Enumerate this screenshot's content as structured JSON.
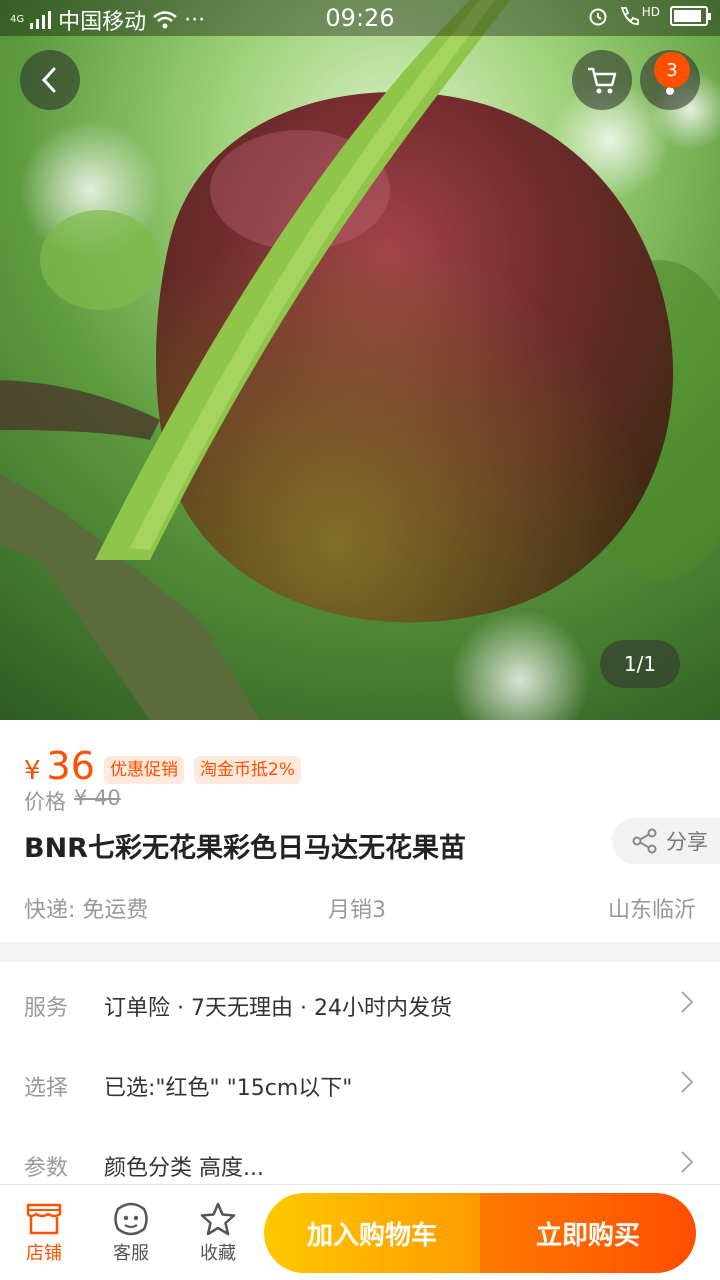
{
  "status_bar": {
    "network": "4G",
    "carrier": "中国移动",
    "more": "···",
    "time": "09:26",
    "hd": "HD",
    "battery_level": 0.9
  },
  "gallery": {
    "pager": "1/1",
    "cart_badge": "3"
  },
  "product": {
    "currency": "¥",
    "price": "36",
    "tags": [
      "优惠促销",
      "淘金币抵2%"
    ],
    "original_label": "价格",
    "original_price": "¥ 40",
    "title": "BNR七彩无花果彩色日马达无花果苗",
    "share_label": "分享",
    "shipping": "快递: 免运费",
    "monthly_sales": "月销3",
    "location": "山东临沂"
  },
  "rows": [
    {
      "label": "服务",
      "value": "订单险 · 7天无理由 · 24小时内发货"
    },
    {
      "label": "选择",
      "value": "已选:\"红色\" \"15cm以下\""
    },
    {
      "label": "参数",
      "value": "颜色分类 高度..."
    }
  ],
  "bottom_bar": {
    "store": "店铺",
    "service": "客服",
    "favorite": "收藏",
    "add_to_cart": "加入购物车",
    "buy_now": "立即购买"
  },
  "colors": {
    "accent": "#ff5000",
    "cart_gradient": [
      "#ffc800",
      "#ff9a00"
    ],
    "buy_gradient": [
      "#ff7a00",
      "#ff4e00"
    ]
  }
}
